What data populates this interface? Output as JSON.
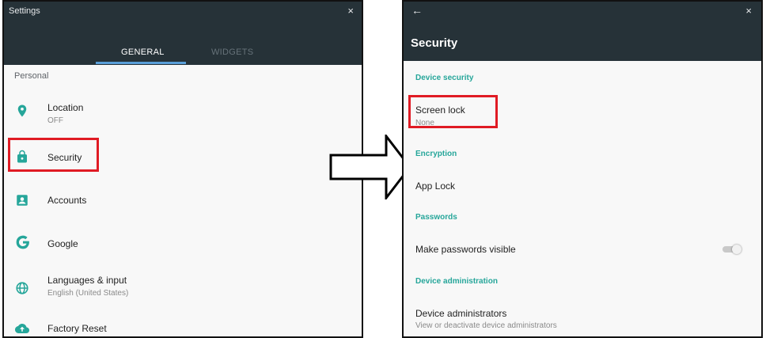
{
  "left": {
    "window_title": "Settings",
    "close_glyph": "×",
    "tabs": [
      {
        "label": "GENERAL",
        "selected": true
      },
      {
        "label": "WIDGETS",
        "selected": false
      }
    ],
    "section": "Personal",
    "items": [
      {
        "title": "Location",
        "subtitle": "OFF",
        "icon": "location-pin-icon"
      },
      {
        "title": "Security",
        "subtitle": "",
        "icon": "lock-icon",
        "highlighted": true
      },
      {
        "title": "Accounts",
        "subtitle": "",
        "icon": "account-box-icon"
      },
      {
        "title": "Google",
        "subtitle": "",
        "icon": "google-g-icon"
      },
      {
        "title": "Languages & input",
        "subtitle": "English (United States)",
        "icon": "globe-icon"
      },
      {
        "title": "Factory Reset",
        "subtitle": "",
        "icon": "cloud-upload-icon"
      }
    ]
  },
  "right": {
    "back_glyph": "←",
    "close_glyph": "×",
    "title": "Security",
    "sections": [
      {
        "label": "Device security",
        "items": [
          {
            "title": "Screen lock",
            "subtitle": "None",
            "highlighted": true
          }
        ]
      },
      {
        "label": "Encryption",
        "items": [
          {
            "title": "App Lock",
            "subtitle": ""
          }
        ]
      },
      {
        "label": "Passwords",
        "items": [
          {
            "title": "Make passwords visible",
            "subtitle": "",
            "toggle": "off"
          }
        ]
      },
      {
        "label": "Device administration",
        "items": [
          {
            "title": "Device administrators",
            "subtitle": "View or deactivate device administrators"
          }
        ]
      }
    ]
  },
  "colors": {
    "header": "#263238",
    "accent": "#26a69a",
    "tab_indicator": "#5a9fd9",
    "highlight": "#e01b24"
  }
}
